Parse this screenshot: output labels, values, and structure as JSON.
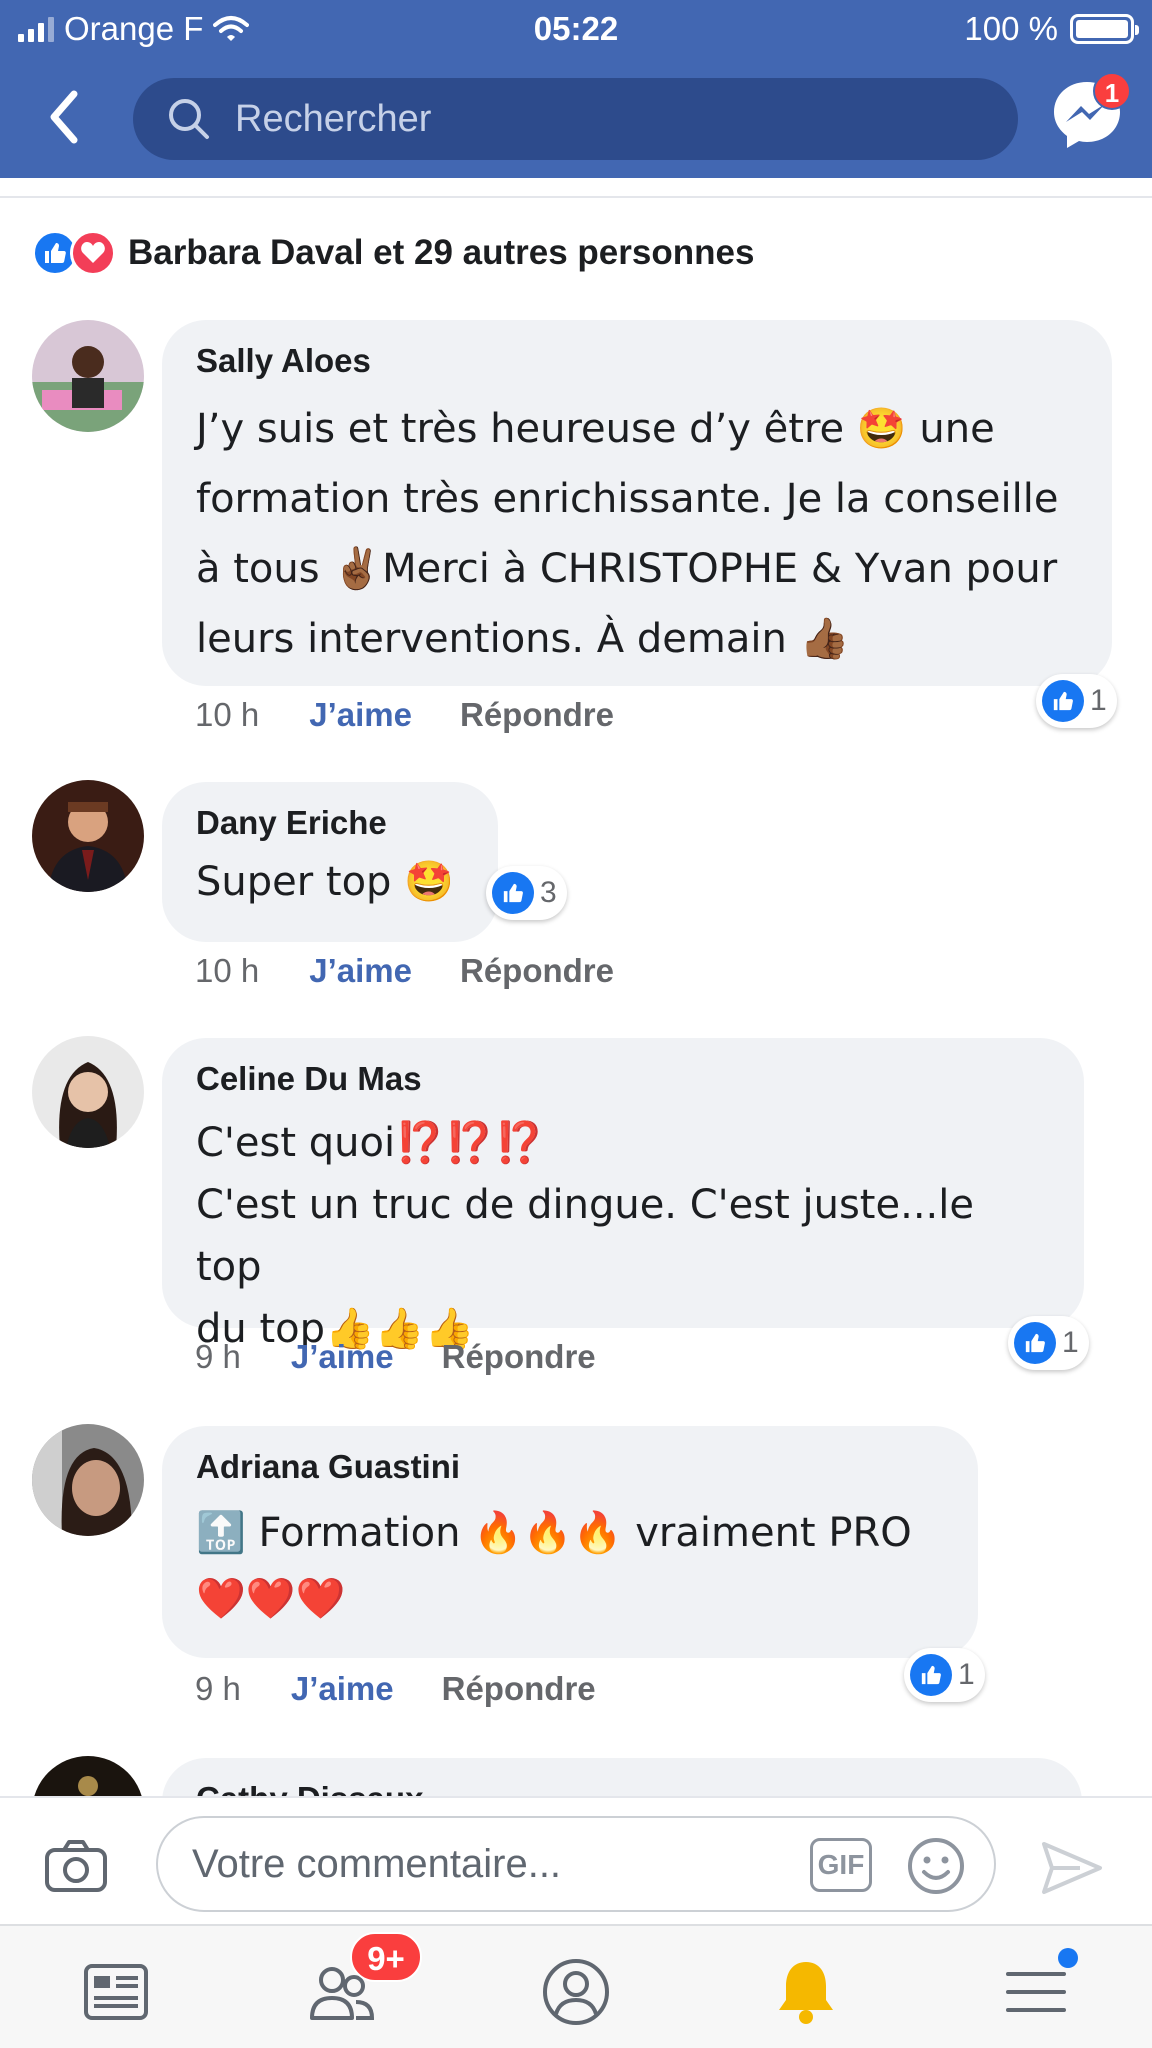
{
  "status": {
    "carrier": "Orange F",
    "time": "05:22",
    "battery": "100 %"
  },
  "nav": {
    "search_placeholder": "Rechercher",
    "messenger_badge": "1"
  },
  "reactions_summary": "Barbara Daval et 29 autres personnes",
  "comments": [
    {
      "author": "Sally Aloes",
      "text": "J’y suis et très heureuse d’y être 🤩 une\nformation très enrichissante. Je la conseille\nà tous ✌🏾Merci à CHRISTOPHE & Yvan pour\nleurs interventions. À demain 👍🏾",
      "time": "10 h",
      "like_label": "J’aime",
      "reply_label": "Répondre",
      "likes": "1"
    },
    {
      "author": "Dany Eriche",
      "text": "Super top 🤩",
      "time": "10 h",
      "like_label": "J’aime",
      "reply_label": "Répondre",
      "likes": "3"
    },
    {
      "author": "Celine Du Mas",
      "text": "C'est quoi⁉️⁉️⁉️\nC'est un truc de dingue. C'est juste...le top\ndu top👍👍👍",
      "time": "9 h",
      "like_label": "J’aime",
      "reply_label": "Répondre",
      "likes": "1"
    },
    {
      "author": "Adriana Guastini",
      "text": "🔝 Formation 🔥🔥🔥 vraiment PRO\n❤️❤️❤️",
      "time": "9 h",
      "like_label": "J’aime",
      "reply_label": "Répondre",
      "likes": "1"
    },
    {
      "author": "Cathy Dissaux"
    }
  ],
  "composer": {
    "placeholder": "Votre commentaire...",
    "gif_label": "GIF"
  },
  "tabbar": {
    "friends_badge": "9+"
  },
  "colors": {
    "brand_blue": "#4267b2",
    "search_bg": "#2d4b8c",
    "like_blue": "#1877f2",
    "love_red": "#f33e58",
    "badge_red": "#fa3e3e",
    "bubble_bg": "#f0f2f5",
    "bell_yellow": "#f5b800"
  },
  "icons": [
    "signal-icon",
    "wifi-icon",
    "battery-icon",
    "back-icon",
    "search-icon",
    "messenger-icon",
    "like-reaction-icon",
    "love-reaction-icon",
    "camera-icon",
    "smiley-icon",
    "send-icon",
    "news-feed-icon",
    "friends-icon",
    "profile-icon",
    "notifications-bell-icon",
    "menu-icon"
  ]
}
